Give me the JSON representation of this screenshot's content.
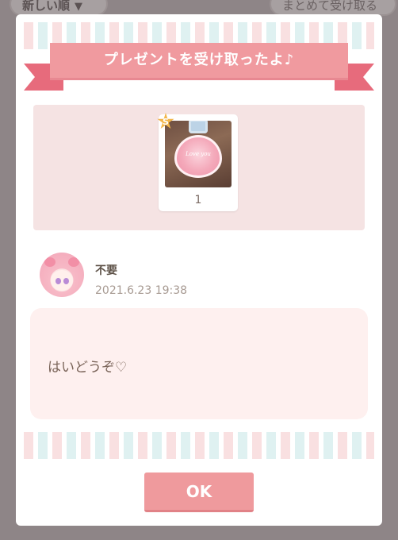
{
  "background": {
    "sort_label": "新しい順",
    "collect_label": "まとめて受け取る"
  },
  "modal": {
    "title": "プレゼントを受け取ったよ♪",
    "item": {
      "rarity": "S",
      "thumbnail_text": "Love you",
      "quantity": "1"
    },
    "sender": {
      "name": "不要",
      "timestamp": "2021.6.23 19:38"
    },
    "message": "はいどうぞ♡",
    "ok_label": "OK"
  },
  "colors": {
    "ribbon": "#f09a9f",
    "ribbon_tail": "#e76b7c",
    "ok_button": "#ef9a9d",
    "panel": "#f5e3e3",
    "message_bg": "#fef0ef"
  }
}
